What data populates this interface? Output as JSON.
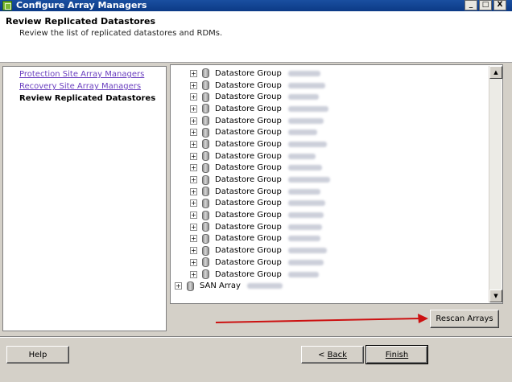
{
  "window": {
    "title": "Configure Array Managers",
    "buttons": [
      "_",
      "□",
      "X"
    ]
  },
  "header": {
    "title": "Review Replicated Datastores",
    "subtitle": "Review the list of replicated datastores and RDMs."
  },
  "steps": [
    {
      "label": "Protection Site Array Managers",
      "state": "link"
    },
    {
      "label": "Recovery Site Array Managers",
      "state": "link"
    },
    {
      "label": "Review Replicated Datastores",
      "state": "current"
    }
  ],
  "tree": {
    "items": [
      {
        "label": "Datastore Group",
        "expander": "+"
      },
      {
        "label": "Datastore Group",
        "expander": "+"
      },
      {
        "label": "Datastore Group",
        "expander": "+"
      },
      {
        "label": "Datastore Group",
        "expander": "+"
      },
      {
        "label": "Datastore Group",
        "expander": "+"
      },
      {
        "label": "Datastore Group",
        "expander": "+"
      },
      {
        "label": "Datastore Group",
        "expander": "+"
      },
      {
        "label": "Datastore Group",
        "expander": "+"
      },
      {
        "label": "Datastore Group",
        "expander": "+"
      },
      {
        "label": "Datastore Group",
        "expander": "+"
      },
      {
        "label": "Datastore Group",
        "expander": "+"
      },
      {
        "label": "Datastore Group",
        "expander": "+"
      },
      {
        "label": "Datastore Group",
        "expander": "+"
      },
      {
        "label": "Datastore Group",
        "expander": "+"
      },
      {
        "label": "Datastore Group",
        "expander": "+"
      },
      {
        "label": "Datastore Group",
        "expander": "+"
      },
      {
        "label": "Datastore Group",
        "expander": "+"
      },
      {
        "label": "Datastore Group",
        "expander": "+"
      }
    ],
    "array": {
      "label": "SAN Array",
      "expander": "+"
    }
  },
  "buttons": {
    "rescan": "Rescan Arrays",
    "help": "Help",
    "back": "Back",
    "back_mnemonic": "<",
    "finish": "Finish"
  },
  "colors": {
    "titlebar": "#0c3a86",
    "dialog_bg": "#d4d0c8",
    "link": "#6a3fbf",
    "annotation_arrow": "#cc1111"
  }
}
